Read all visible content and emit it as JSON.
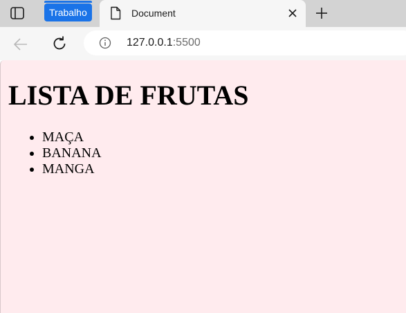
{
  "browser": {
    "tab_group_label": "Trabalho",
    "tab_title": "Document",
    "url_host": "127.0.0.1",
    "url_port": ":5500",
    "tab_group_color": "#1a73e8"
  },
  "page": {
    "background_color": "#ffebee",
    "heading": "LISTA DE FRUTAS",
    "fruits": [
      "MAÇA",
      "BANANA",
      "MANGA"
    ]
  }
}
